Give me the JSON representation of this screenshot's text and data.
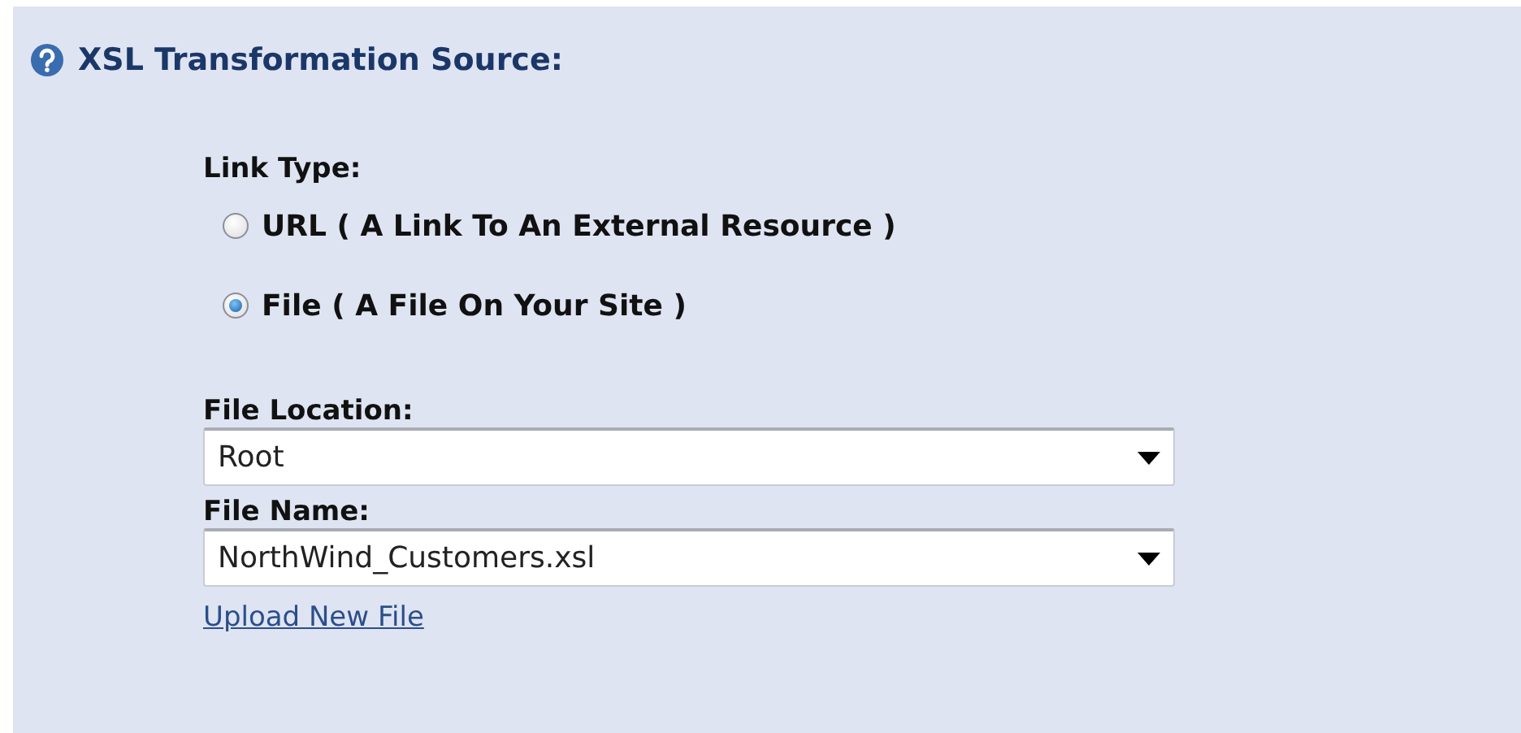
{
  "section": {
    "title": "XSL Transformation Source:"
  },
  "link_type": {
    "label": "Link Type:",
    "options": [
      {
        "label": "URL ( A Link To An External Resource )",
        "selected": false
      },
      {
        "label": "File ( A File On Your Site )",
        "selected": true
      }
    ]
  },
  "fields": [
    {
      "label": "File Location:",
      "value": "Root"
    },
    {
      "label": "File Name:",
      "value": "NorthWind_Customers.xsl"
    }
  ],
  "upload_link": "Upload New File"
}
